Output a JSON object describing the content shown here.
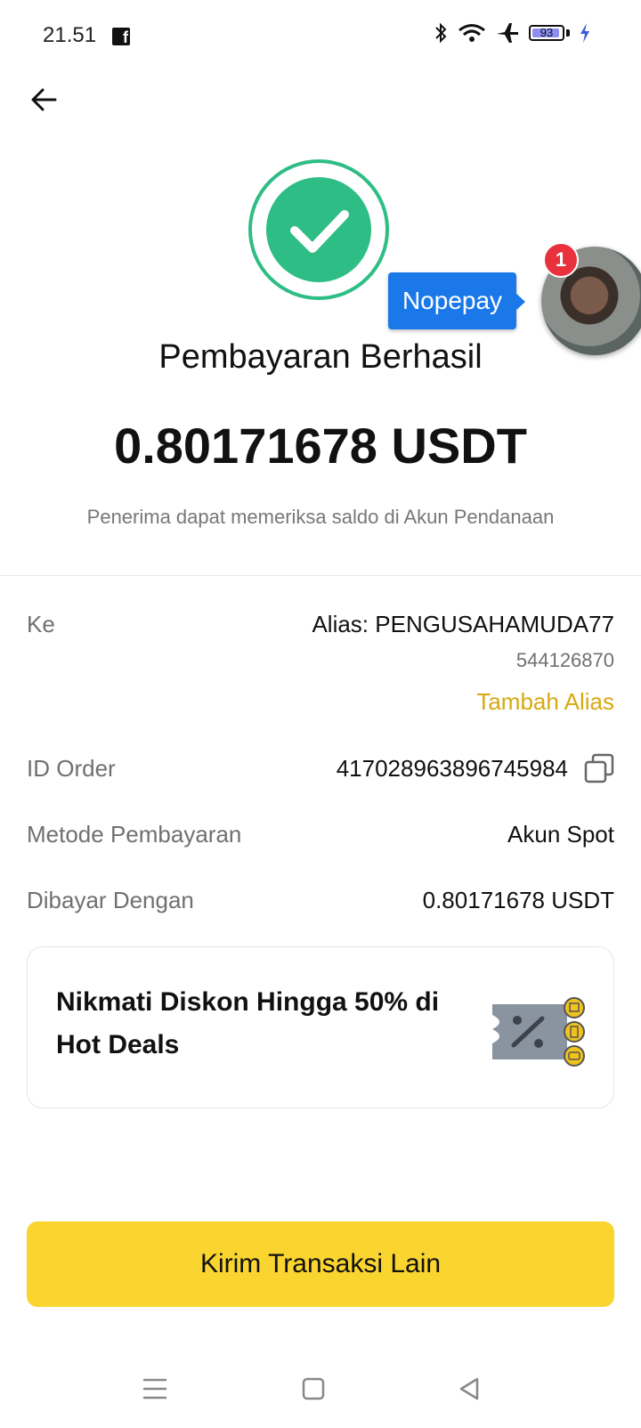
{
  "status_bar": {
    "time": "21.51",
    "battery_level": "93",
    "battery_fraction": 0.93
  },
  "bubble": {
    "label": "Nopepay",
    "badge_count": "1"
  },
  "result": {
    "title": "Pembayaran Berhasil",
    "amount": "0.80171678 USDT",
    "note": "Penerima dapat memeriksa saldo di Akun Pendanaan"
  },
  "details": {
    "to_label": "Ke",
    "to_alias": "Alias: PENGUSAHAMUDA77",
    "to_id": "544126870",
    "add_alias_label": "Tambah Alias",
    "order_label": "ID Order",
    "order_value": "417028963896745984",
    "method_label": "Metode Pembayaran",
    "method_value": "Akun Spot",
    "paid_label": "Dibayar Dengan",
    "paid_value": "0.80171678 USDT"
  },
  "promo": {
    "text": "Nikmati Diskon Hingga 50% di Hot Deals"
  },
  "cta": {
    "label": "Kirim Transaksi Lain"
  },
  "colors": {
    "success": "#2ebd85",
    "accent_link": "#d7a812",
    "cta": "#fad530",
    "bubble": "#1a78e8"
  },
  "icons": [
    "back-arrow-icon",
    "check-icon",
    "copy-icon",
    "voucher-icon",
    "menu-nav-icon",
    "home-nav-icon",
    "back-nav-icon"
  ]
}
